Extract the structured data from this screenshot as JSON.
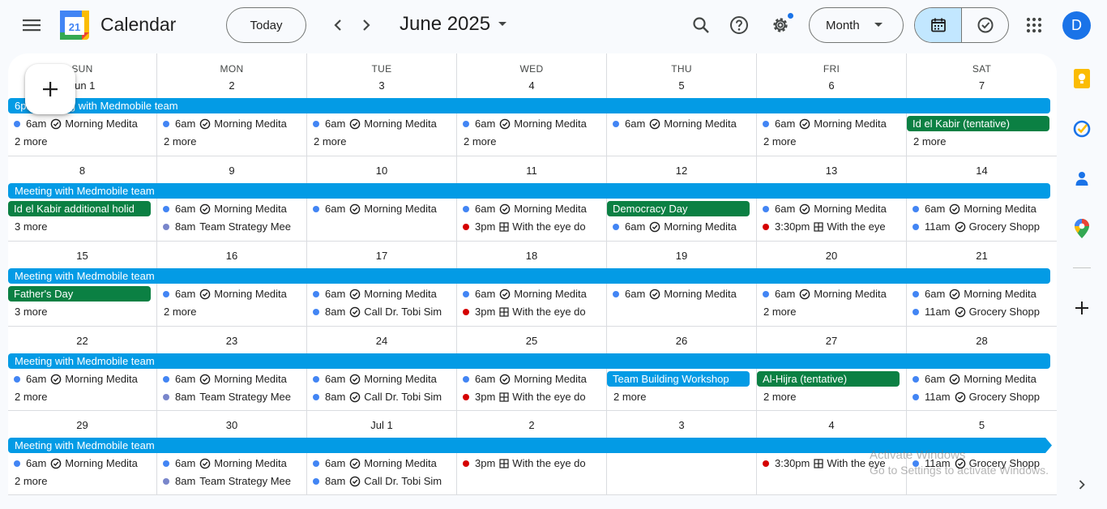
{
  "header": {
    "app_title": "Calendar",
    "logo_day": "21",
    "today_label": "Today",
    "month_label": "June 2025",
    "view_label": "Month",
    "avatar_initial": "D"
  },
  "colors": {
    "accent": "#1a73e8",
    "event_blue": "#039be5",
    "holiday_green": "#0b8043",
    "dot_blue": "#4285f4",
    "dot_lavender": "#7986cb",
    "dot_red": "#d50000"
  },
  "weekdays": [
    "SUN",
    "MON",
    "TUE",
    "WED",
    "THU",
    "FRI",
    "SAT"
  ],
  "weeks": [
    {
      "dates": [
        "Jun 1",
        "2",
        "3",
        "4",
        "5",
        "6",
        "7"
      ],
      "span": "6pm Meeting with Medmobile team",
      "cells": [
        {
          "l1": {
            "t": "ev",
            "dot": "blue",
            "time": "6am",
            "icon": "task",
            "title": "Morning Medita"
          },
          "l2": {
            "t": "more",
            "text": "2 more"
          }
        },
        {
          "l1": {
            "t": "ev",
            "dot": "blue",
            "time": "6am",
            "icon": "task",
            "title": "Morning Medita"
          },
          "l2": {
            "t": "more",
            "text": "2 more"
          }
        },
        {
          "l1": {
            "t": "ev",
            "dot": "blue",
            "time": "6am",
            "icon": "task",
            "title": "Morning Medita"
          },
          "l2": {
            "t": "more",
            "text": "2 more"
          }
        },
        {
          "l1": {
            "t": "ev",
            "dot": "blue",
            "time": "6am",
            "icon": "task",
            "title": "Morning Medita"
          },
          "l2": {
            "t": "more",
            "text": "2 more"
          }
        },
        {
          "l1": {
            "t": "ev",
            "dot": "blue",
            "time": "6am",
            "icon": "task",
            "title": "Morning Medita"
          }
        },
        {
          "l1": {
            "t": "ev",
            "dot": "blue",
            "time": "6am",
            "icon": "task",
            "title": "Morning Medita"
          },
          "l2": {
            "t": "more",
            "text": "2 more"
          }
        },
        {
          "l1": {
            "t": "chip",
            "color": "green",
            "text": "Id el Kabir (tentative)"
          },
          "l2": {
            "t": "more",
            "text": "2 more"
          }
        }
      ]
    },
    {
      "dates": [
        "8",
        "9",
        "10",
        "11",
        "12",
        "13",
        "14"
      ],
      "span": "Meeting with Medmobile team",
      "cells": [
        {
          "l1": {
            "t": "chip",
            "color": "green",
            "text": "Id el Kabir additional holid"
          },
          "l2": {
            "t": "more",
            "text": "3 more"
          }
        },
        {
          "l1": {
            "t": "ev",
            "dot": "blue",
            "time": "6am",
            "icon": "task",
            "title": "Morning Medita"
          },
          "l2": {
            "t": "ev",
            "dot": "lavender",
            "time": "8am",
            "icon": "",
            "title": "Team Strategy Mee"
          }
        },
        {
          "l1": {
            "t": "ev",
            "dot": "blue",
            "time": "6am",
            "icon": "task",
            "title": "Morning Medita"
          }
        },
        {
          "l1": {
            "t": "ev",
            "dot": "blue",
            "time": "6am",
            "icon": "task",
            "title": "Morning Medita"
          },
          "l2": {
            "t": "ev",
            "dot": "red",
            "time": "3pm",
            "icon": "grid",
            "title": "With the eye do"
          }
        },
        {
          "l1": {
            "t": "chip",
            "color": "green",
            "text": "Democracy Day"
          },
          "l2": {
            "t": "ev",
            "dot": "blue",
            "time": "6am",
            "icon": "task",
            "title": "Morning Medita"
          }
        },
        {
          "l1": {
            "t": "ev",
            "dot": "blue",
            "time": "6am",
            "icon": "task",
            "title": "Morning Medita"
          },
          "l2": {
            "t": "ev",
            "dot": "red",
            "time": "3:30pm",
            "icon": "grid",
            "title": "With the eye"
          }
        },
        {
          "l1": {
            "t": "ev",
            "dot": "blue",
            "time": "6am",
            "icon": "task",
            "title": "Morning Medita"
          },
          "l2": {
            "t": "ev",
            "dot": "blue",
            "time": "11am",
            "icon": "task",
            "title": "Grocery Shopp"
          }
        }
      ]
    },
    {
      "dates": [
        "15",
        "16",
        "17",
        "18",
        "19",
        "20",
        "21"
      ],
      "span": "Meeting with Medmobile team",
      "cells": [
        {
          "l1": {
            "t": "chip",
            "color": "green",
            "text": "Father's Day"
          },
          "l2": {
            "t": "more",
            "text": "3 more"
          }
        },
        {
          "l1": {
            "t": "ev",
            "dot": "blue",
            "time": "6am",
            "icon": "task",
            "title": "Morning Medita"
          },
          "l2": {
            "t": "more",
            "text": "2 more"
          }
        },
        {
          "l1": {
            "t": "ev",
            "dot": "blue",
            "time": "6am",
            "icon": "task",
            "title": "Morning Medita"
          },
          "l2": {
            "t": "ev",
            "dot": "blue",
            "time": "8am",
            "icon": "task",
            "title": "Call Dr. Tobi Sim"
          }
        },
        {
          "l1": {
            "t": "ev",
            "dot": "blue",
            "time": "6am",
            "icon": "task",
            "title": "Morning Medita"
          },
          "l2": {
            "t": "ev",
            "dot": "red",
            "time": "3pm",
            "icon": "grid",
            "title": "With the eye do"
          }
        },
        {
          "l1": {
            "t": "ev",
            "dot": "blue",
            "time": "6am",
            "icon": "task",
            "title": "Morning Medita"
          }
        },
        {
          "l1": {
            "t": "ev",
            "dot": "blue",
            "time": "6am",
            "icon": "task",
            "title": "Morning Medita"
          },
          "l2": {
            "t": "more",
            "text": "2 more"
          }
        },
        {
          "l1": {
            "t": "ev",
            "dot": "blue",
            "time": "6am",
            "icon": "task",
            "title": "Morning Medita"
          },
          "l2": {
            "t": "ev",
            "dot": "blue",
            "time": "11am",
            "icon": "task",
            "title": "Grocery Shopp"
          }
        }
      ]
    },
    {
      "dates": [
        "22",
        "23",
        "24",
        "25",
        "26",
        "27",
        "28"
      ],
      "span": "Meeting with Medmobile team",
      "cells": [
        {
          "l1": {
            "t": "ev",
            "dot": "blue",
            "time": "6am",
            "icon": "task",
            "title": "Morning Medita"
          },
          "l2": {
            "t": "more",
            "text": "2 more"
          }
        },
        {
          "l1": {
            "t": "ev",
            "dot": "blue",
            "time": "6am",
            "icon": "task",
            "title": "Morning Medita"
          },
          "l2": {
            "t": "ev",
            "dot": "lavender",
            "time": "8am",
            "icon": "",
            "title": "Team Strategy Mee"
          }
        },
        {
          "l1": {
            "t": "ev",
            "dot": "blue",
            "time": "6am",
            "icon": "task",
            "title": "Morning Medita"
          },
          "l2": {
            "t": "ev",
            "dot": "blue",
            "time": "8am",
            "icon": "task",
            "title": "Call Dr. Tobi Sim"
          }
        },
        {
          "l1": {
            "t": "ev",
            "dot": "blue",
            "time": "6am",
            "icon": "task",
            "title": "Morning Medita"
          },
          "l2": {
            "t": "ev",
            "dot": "red",
            "time": "3pm",
            "icon": "grid",
            "title": "With the eye do"
          }
        },
        {
          "l1": {
            "t": "chip",
            "color": "blue",
            "text": "Team Building Workshop"
          },
          "l2": {
            "t": "more",
            "text": "2 more"
          }
        },
        {
          "l1": {
            "t": "chip",
            "color": "green",
            "text": "Al-Hijra (tentative)"
          },
          "l2": {
            "t": "more",
            "text": "2 more"
          }
        },
        {
          "l1": {
            "t": "ev",
            "dot": "blue",
            "time": "6am",
            "icon": "task",
            "title": "Morning Medita"
          },
          "l2": {
            "t": "ev",
            "dot": "blue",
            "time": "11am",
            "icon": "task",
            "title": "Grocery Shopp"
          }
        }
      ]
    },
    {
      "dates": [
        "29",
        "30",
        "Jul 1",
        "2",
        "3",
        "4",
        "5"
      ],
      "span": "Meeting with Medmobile team",
      "cells": [
        {
          "l1": {
            "t": "ev",
            "dot": "blue",
            "time": "6am",
            "icon": "task",
            "title": "Morning Medita"
          },
          "l2": {
            "t": "more",
            "text": "2 more"
          }
        },
        {
          "l1": {
            "t": "ev",
            "dot": "blue",
            "time": "6am",
            "icon": "task",
            "title": "Morning Medita"
          },
          "l2": {
            "t": "ev",
            "dot": "lavender",
            "time": "8am",
            "icon": "",
            "title": "Team Strategy Mee"
          }
        },
        {
          "l1": {
            "t": "ev",
            "dot": "blue",
            "time": "6am",
            "icon": "task",
            "title": "Morning Medita"
          },
          "l2": {
            "t": "ev",
            "dot": "blue",
            "time": "8am",
            "icon": "task",
            "title": "Call Dr. Tobi Sim"
          }
        },
        {
          "l1": {
            "t": "ev",
            "dot": "red",
            "time": "3pm",
            "icon": "grid",
            "title": "With the eye do"
          }
        },
        {},
        {
          "l1": {
            "t": "ev",
            "dot": "red",
            "time": "3:30pm",
            "icon": "grid",
            "title": "With the eye"
          }
        },
        {
          "l1": {
            "t": "ev",
            "dot": "blue",
            "time": "11am",
            "icon": "task",
            "title": "Grocery Shopp"
          }
        }
      ]
    }
  ],
  "sidebar": {
    "icons": [
      "keep-icon",
      "tasks-icon",
      "contacts-icon",
      "maps-icon",
      "add-icon",
      "chevron-right-icon"
    ]
  },
  "watermark": {
    "line1": "Activate Windows",
    "line2": "Go to Settings to activate Windows."
  }
}
